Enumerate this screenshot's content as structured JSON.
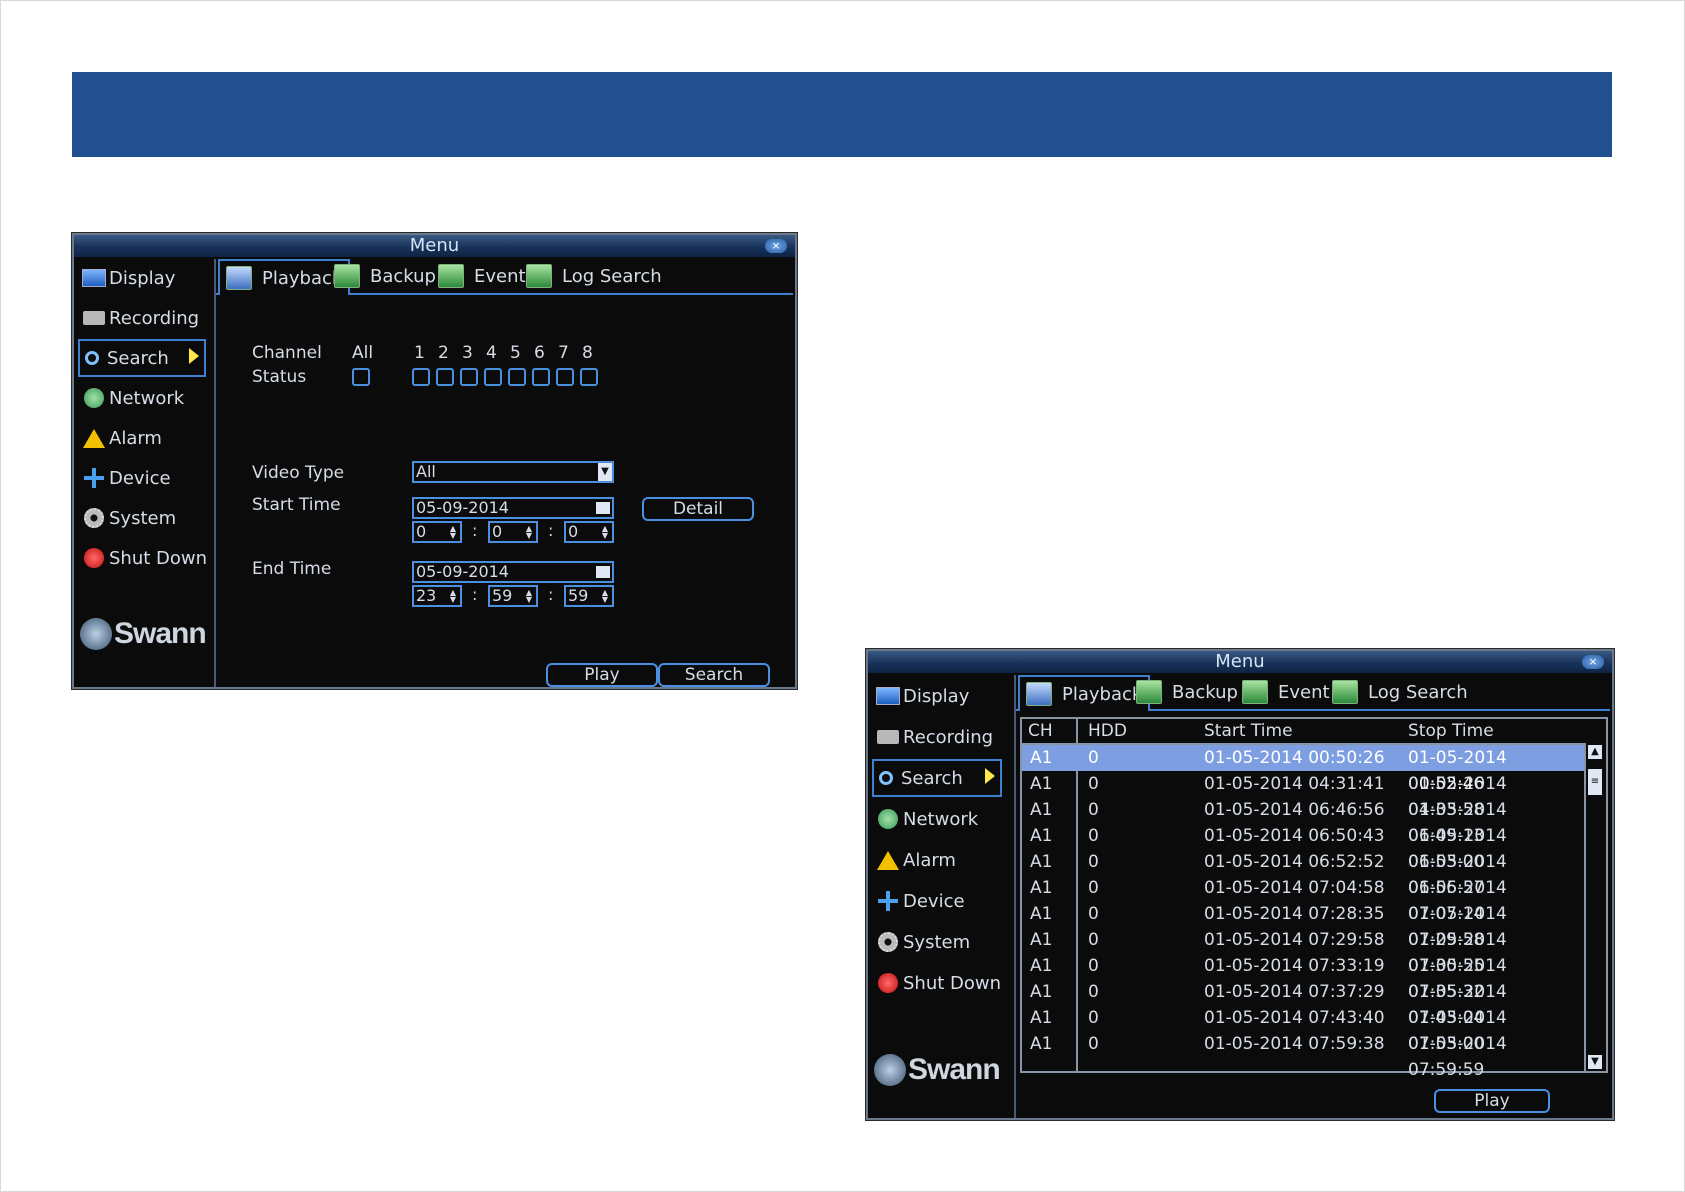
{
  "window": {
    "title": "Menu",
    "close": "×"
  },
  "sidebar": {
    "items": [
      {
        "label": "Display"
      },
      {
        "label": "Recording"
      },
      {
        "label": "Search"
      },
      {
        "label": "Network"
      },
      {
        "label": "Alarm"
      },
      {
        "label": "Device"
      },
      {
        "label": "System"
      },
      {
        "label": "Shut Down"
      }
    ],
    "logo": "Swann"
  },
  "tabs": [
    {
      "label": "Playback"
    },
    {
      "label": "Backup"
    },
    {
      "label": "Event"
    },
    {
      "label": "Log Search"
    }
  ],
  "search_form": {
    "channel_label": "Channel",
    "status_label": "Status",
    "all_label": "All",
    "channels": [
      "1",
      "2",
      "3",
      "4",
      "5",
      "6",
      "7",
      "8"
    ],
    "video_type_label": "Video Type",
    "video_type_value": "All",
    "start_time_label": "Start Time",
    "start_date": "05-09-2014",
    "start_h": "0",
    "start_m": "0",
    "start_s": "0",
    "end_time_label": "End Time",
    "end_date": "05-09-2014",
    "end_h": "23",
    "end_m": "59",
    "end_s": "59",
    "colon": ":",
    "detail_button": "Detail",
    "play_button": "Play",
    "search_button": "Search"
  },
  "results": {
    "columns": [
      "CH",
      "HDD",
      "Start Time",
      "Stop Time"
    ],
    "rows": [
      [
        "A1",
        "0",
        "01-05-2014 00:50:26",
        "01-05-2014 00:52:46"
      ],
      [
        "A1",
        "0",
        "01-05-2014 04:31:41",
        "01-05-2014 04:33:58"
      ],
      [
        "A1",
        "0",
        "01-05-2014 06:46:56",
        "01-05-2014 06:49:13"
      ],
      [
        "A1",
        "0",
        "01-05-2014 06:50:43",
        "01-05-2014 06:53:00"
      ],
      [
        "A1",
        "0",
        "01-05-2014 06:52:52",
        "01-05-2014 06:56:57"
      ],
      [
        "A1",
        "0",
        "01-05-2014 07:04:58",
        "01-05-2014 07:07:14"
      ],
      [
        "A1",
        "0",
        "01-05-2014 07:28:35",
        "01-05-2014 07:29:58"
      ],
      [
        "A1",
        "0",
        "01-05-2014 07:29:58",
        "01-05-2014 07:30:55"
      ],
      [
        "A1",
        "0",
        "01-05-2014 07:33:19",
        "01-05-2014 07:35:32"
      ],
      [
        "A1",
        "0",
        "01-05-2014 07:37:29",
        "01-05-2014 07:43:04"
      ],
      [
        "A1",
        "0",
        "01-05-2014 07:43:40",
        "01-05-2014 07:53:00"
      ],
      [
        "A1",
        "0",
        "01-05-2014 07:59:38",
        "01-05-2014 07:59:59"
      ]
    ],
    "play_button": "Play"
  },
  "colors": {
    "banner": "#224f8f",
    "accent": "#4a90e0",
    "selected_row": "#7d9ee0",
    "arrow": "#ffe84a"
  }
}
